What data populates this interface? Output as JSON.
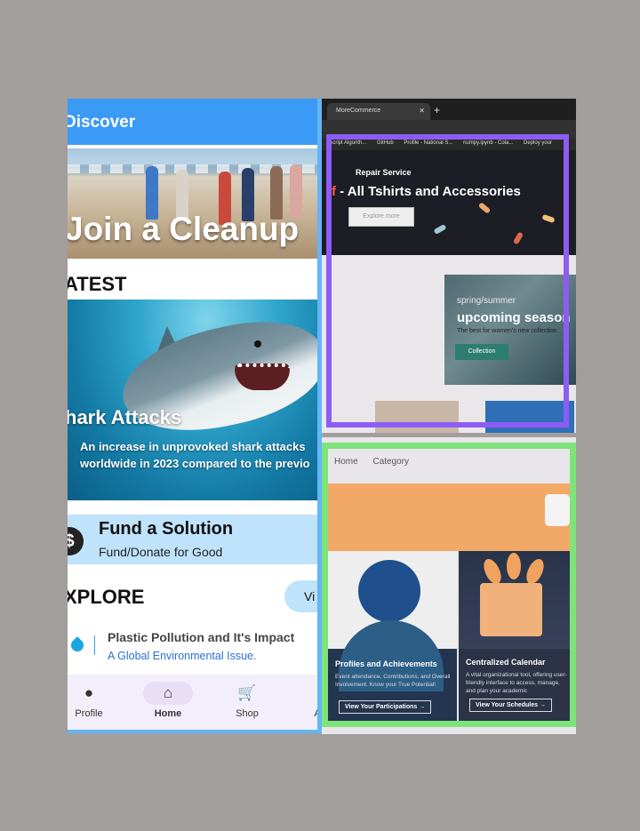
{
  "phone": {
    "app_title": "Discover",
    "cleanup_banner": "Join a Cleanup",
    "latest_heading": "ATEST",
    "shark": {
      "title": "hark Attacks",
      "desc_line1": "An increase in unprovoked shark attacks",
      "desc_line2": "worldwide in 2023 compared to the previo"
    },
    "fund": {
      "title": "Fund a Solution",
      "subtitle": "Fund/Donate for Good",
      "icon_glyph": "$"
    },
    "explore_heading": "XPLORE",
    "view_button": "Vi",
    "explore_item": {
      "title": "Plastic Pollution and It's Impact",
      "subtitle": "A Global Environmental Issue."
    },
    "nav": [
      {
        "label": "Profile",
        "icon": "profile-icon",
        "glyph": "👤"
      },
      {
        "label": "Home",
        "icon": "home-icon",
        "glyph": "⌂",
        "active": true
      },
      {
        "label": "Shop",
        "icon": "cart-icon",
        "glyph": "🛒"
      },
      {
        "label": "A",
        "icon": "",
        "glyph": ""
      }
    ],
    "accent_color": "#3b9af5"
  },
  "photo1": {
    "tab_title": "MoreCommerce",
    "bookmarks": [
      "ascript Algorith...",
      "GitHub",
      "Profile - National S...",
      "numpy.ipynb - Cola...",
      "Deploy your"
    ],
    "repair_service": "Repair Service",
    "headline_prefix": "ff",
    "headline": " - All Tshirts and Accessories",
    "explore_button": "Explore more",
    "promo": {
      "spring": "spring/summer",
      "season": "upcoming season",
      "small": "The best for women's new collection",
      "collection_button": "Collection"
    },
    "frame_color": "#8d5cf5"
  },
  "photo2": {
    "nav": [
      "Home",
      "Category"
    ],
    "card1": {
      "title": "Profiles and Achievements",
      "desc": "Event attendance, Contributions, and Overall Involvement. Know your True Potential!",
      "button": "View Your Participations →"
    },
    "card2": {
      "title": "Centralized Calendar",
      "desc": "A vital organizational tool, offering user-friendly interface to access, manage, and plan your academic",
      "button": "View Your Schedules →"
    },
    "frame_color": "#7ee37a"
  }
}
